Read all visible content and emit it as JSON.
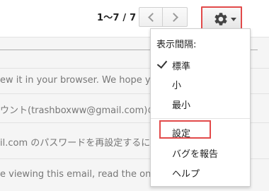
{
  "toolbar": {
    "pager": "1〜7 / 7",
    "prev_label": "",
    "next_label": ""
  },
  "icons": {
    "prev": "chevron-left-icon",
    "next": "chevron-right-icon",
    "settings": "gear-icon",
    "caret": "chevron-down-icon",
    "check": "check-icon"
  },
  "emails": [
    {
      "text": "――――――――――――――――――――――――――――"
    },
    {
      "text": "ew it in your browser. We hope you"
    },
    {
      "text": "ウント(trashboxww@gmail.com)の"
    },
    {
      "text": "il.com のパスワードを再設定するに"
    },
    {
      "text": "e viewing this email, read the online"
    }
  ],
  "menu": {
    "header": "表示間隔:",
    "items": [
      {
        "label": "標準",
        "checked": true
      },
      {
        "label": "小",
        "checked": false
      },
      {
        "label": "最小",
        "checked": false
      }
    ],
    "settings": "設定",
    "report": "バグを報告",
    "help": "ヘルプ"
  },
  "colors": {
    "highlight": "#e24a4a",
    "list_bg": "#f5f5f5"
  }
}
